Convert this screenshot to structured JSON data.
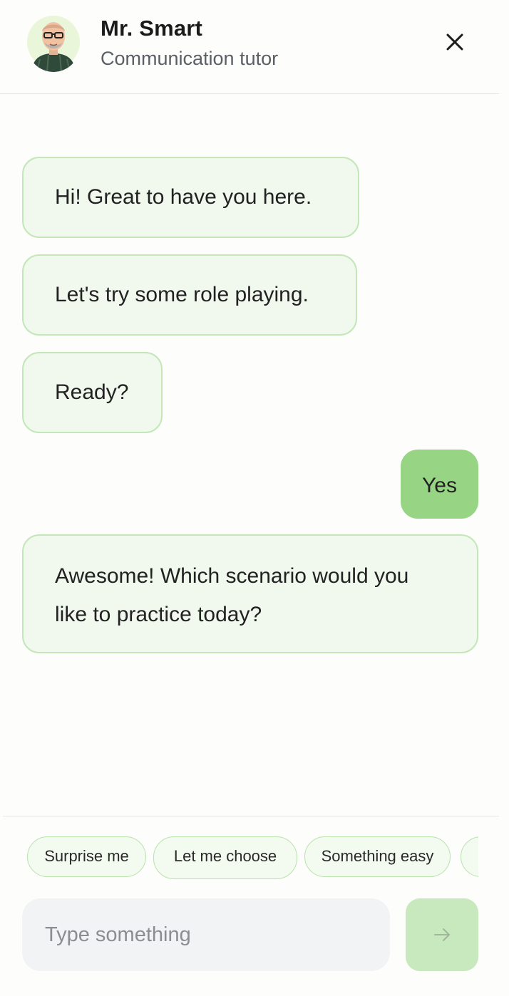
{
  "header": {
    "name": "Mr. Smart",
    "subtitle": "Communication tutor"
  },
  "messages": [
    {
      "from": "tutor",
      "text": "Hi! Great to have you here."
    },
    {
      "from": "tutor",
      "text": "Let's try some role playing."
    },
    {
      "from": "tutor",
      "text": "Ready?"
    },
    {
      "from": "user",
      "text": "Yes"
    },
    {
      "from": "tutor",
      "text": "Awesome! Which scenario would you like to practice today?"
    }
  ],
  "suggestions": [
    "Surprise me",
    "Let me choose",
    "Something easy"
  ],
  "composer": {
    "placeholder": "Type something"
  },
  "colors": {
    "tutor_bubble_bg": "#f1f9ee",
    "tutor_bubble_border": "#c3e7b8",
    "user_bubble_bg": "#97d584",
    "send_button_bg": "#c8e8be"
  },
  "icons": {
    "close": "close-icon",
    "send": "arrow-right-icon",
    "avatar": "tutor-avatar"
  }
}
